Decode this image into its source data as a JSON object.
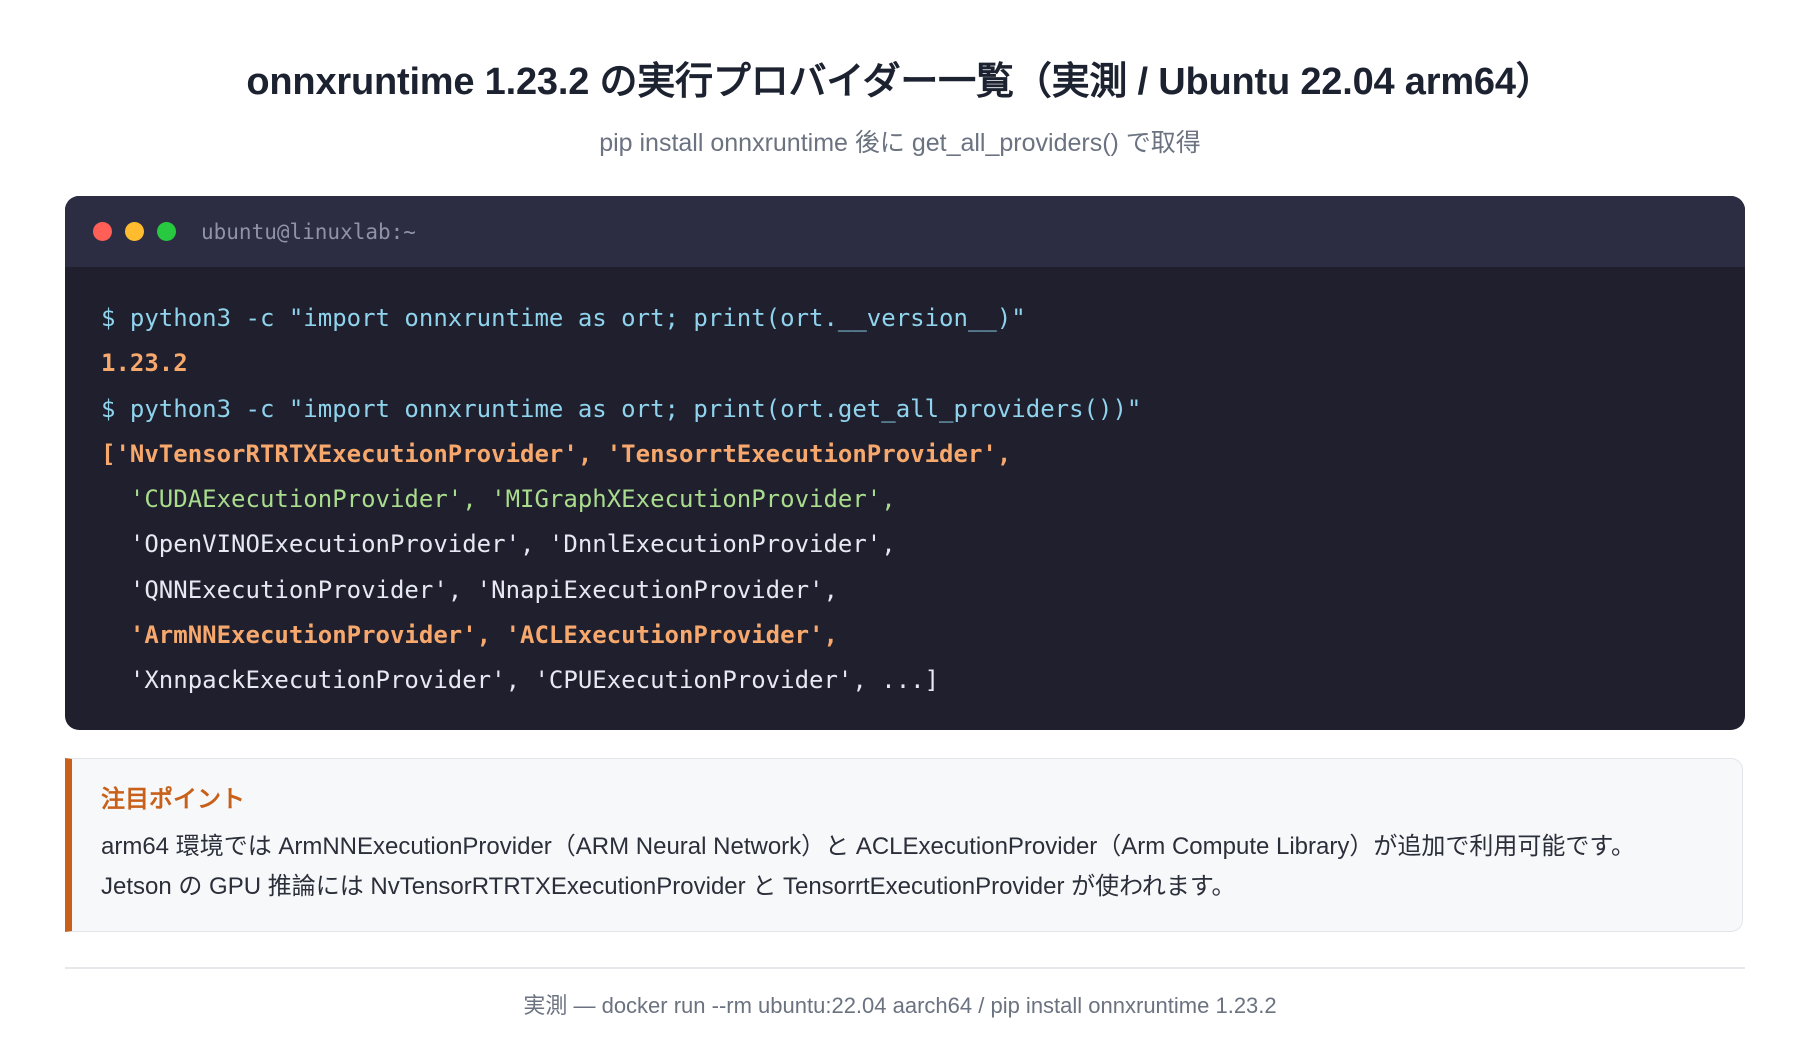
{
  "header": {
    "title": "onnxruntime 1.23.2 の実行プロバイダー一覧（実測 / Ubuntu 22.04 arm64）",
    "subtitle": "pip install onnxruntime 後に get_all_providers() で取得"
  },
  "terminal": {
    "title": "ubuntu@linuxlab:~",
    "colors": {
      "background": "#1f1f2e",
      "titlebar": "#2c2d42",
      "command": "#8fd3ec",
      "highlight_orange": "#f7a86c",
      "highlight_green": "#a9dc8c",
      "plain": "#e6e8f2"
    },
    "lines": {
      "cmd1": "$ python3 -c \"import onnxruntime as ort; print(ort.__version__)\"",
      "out1": "1.23.2",
      "cmd2": "$ python3 -c \"import onnxruntime as ort; print(ort.get_all_providers())\"",
      "out2_a": "['NvTensorRTRTXExecutionProvider', 'TensorrtExecutionProvider'",
      "out2_a_end": ",",
      "out2_b": "  'CUDAExecutionProvider', 'MIGraphXExecutionProvider'",
      "out2_b_end": ",",
      "out2_c": "  'OpenVINOExecutionProvider', 'DnnlExecutionProvider',",
      "out2_d": "  'QNNExecutionProvider', 'NnapiExecutionProvider',",
      "out2_e": "  'ArmNNExecutionProvider', 'ACLExecutionProvider'",
      "out2_e_end": ",",
      "out2_f": "  'XnnpackExecutionProvider', 'CPUExecutionProvider', ...]"
    }
  },
  "note": {
    "title": "注目ポイント",
    "line1": "arm64 環境では ArmNNExecutionProvider（ARM Neural Network）と ACLExecutionProvider（Arm Compute Library）が追加で利用可能です。",
    "line2": "Jetson の GPU 推論には NvTensorRTRTXExecutionProvider と TensorrtExecutionProvider が使われます。",
    "accent_color": "#c8601a"
  },
  "footer": {
    "text": "実測 — docker run --rm ubuntu:22.04 aarch64 / pip install onnxruntime 1.23.2"
  }
}
